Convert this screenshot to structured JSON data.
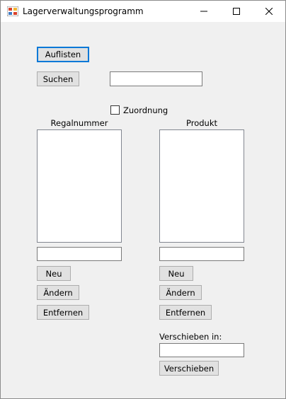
{
  "window": {
    "title": "Lagerverwaltungsprogramm",
    "controls": {
      "minimize": "–",
      "maximize": "☐",
      "close": "✕"
    }
  },
  "toolbar": {
    "list_button": "Auflisten",
    "search_button": "Suchen",
    "search_value": ""
  },
  "assignment_checkbox": {
    "label": "Zuordnung",
    "checked": false
  },
  "shelf_panel": {
    "header": "Regalnummer",
    "items": [],
    "input_value": "",
    "new_button": "Neu",
    "edit_button": "Ändern",
    "remove_button": "Entfernen"
  },
  "product_panel": {
    "header": "Produkt",
    "items": [],
    "input_value": "",
    "new_button": "Neu",
    "edit_button": "Ändern",
    "remove_button": "Entfernen",
    "move_label": "Verschieben in:",
    "move_value": "",
    "move_button": "Verschieben"
  },
  "colors": {
    "accent": "#0078d7",
    "button_face": "#e1e1e1",
    "window_bg": "#f0f0f0"
  }
}
